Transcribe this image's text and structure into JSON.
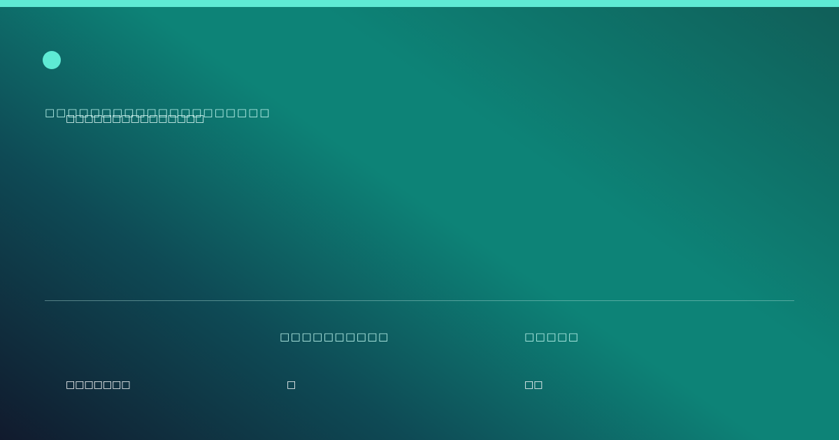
{
  "colors": {
    "accent": "#5eead4",
    "background_dark": "#111a2d",
    "background_teal": "#0d8377"
  },
  "header": {
    "logo_icon": "teal-circle-icon",
    "eyebrow": "□□□□□□□□□□□□□□□□□□□□",
    "subtitle": "□□□□□□□□□□□□□□□"
  },
  "stats": [
    {
      "label": "",
      "value": "□□□□□□□"
    },
    {
      "label": "□□□□□□□□□□",
      "value": "□"
    },
    {
      "label": "□□□□□",
      "value": "□□"
    }
  ]
}
